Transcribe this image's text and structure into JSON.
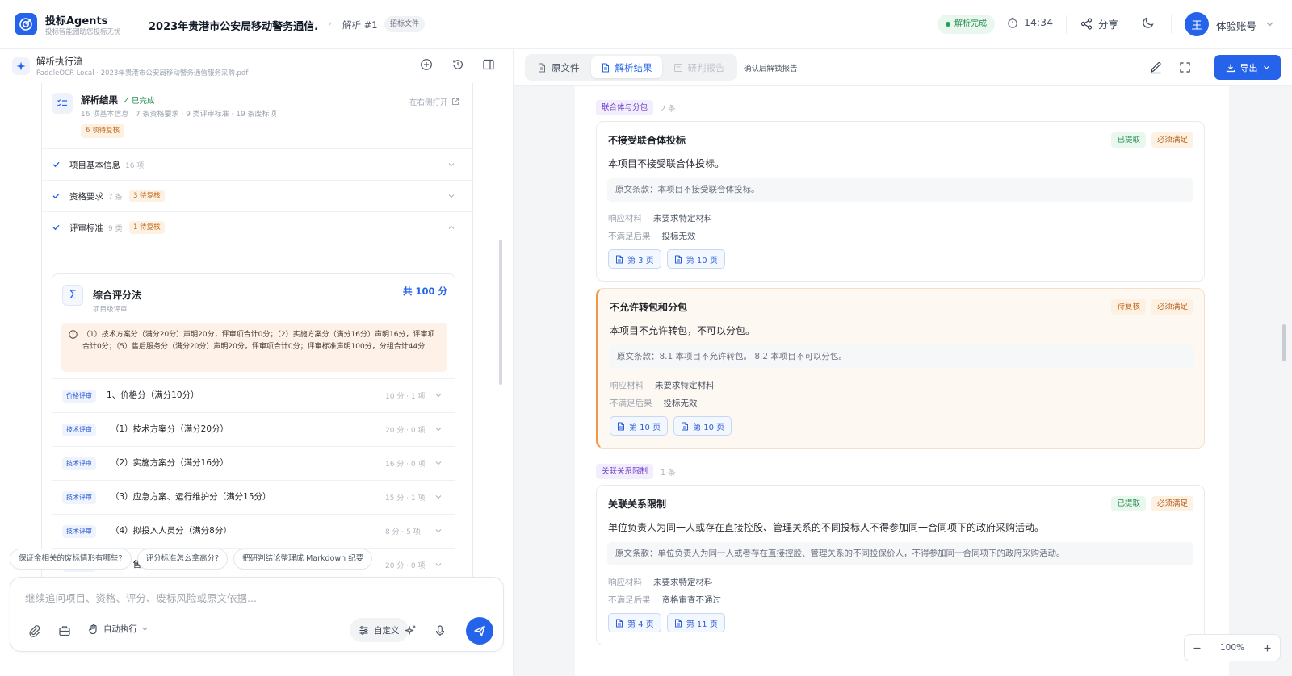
{
  "app": {
    "name": "投标Agents",
    "tagline": "投标智能团助您投标无忧",
    "title": "2023年贵港市公安局移动警务通信...",
    "run": "解析 #1",
    "doc_tag": "招标文件"
  },
  "header": {
    "status": "解析完成",
    "timer": "14:34",
    "share": "分享",
    "avatar_initial": "王",
    "account": "体验账号"
  },
  "left": {
    "title": "解析执行流",
    "subtitle": "PaddleOCR Local · 2023年贵港市公安局移动警务通信服务采购.pdf",
    "result": {
      "title": "解析结果",
      "done": "✓ 已完成",
      "meta": "16 项基本信息 · 7 条资格要求 · 9 类评审标准 · 19 条废标项",
      "pending": "6 项待复核",
      "open": "在右侧打开"
    },
    "sections": [
      {
        "label": "项目基本信息",
        "count": "16 项",
        "pending": ""
      },
      {
        "label": "资格要求",
        "count": "7 条",
        "pending": "3 待复核"
      },
      {
        "label": "评审标准",
        "count": "9 类",
        "pending": "1 待复核"
      }
    ],
    "eval": {
      "title": "综合评分法",
      "subtitle": "项目级评审",
      "total": "共 100 分",
      "note": "（1）技术方案分（满分20分）声明20分，评审项合计0分；（2）实施方案分（满分16分）声明16分，评审项合计0分；（5）售后服务分（满分20分）声明20分，评审项合计0分；评审标准声明100分，分组合计44分",
      "criteria": [
        {
          "tag": "价格评审",
          "name": "1、价格分（满分10分）",
          "score": "10 分 · 1 项"
        },
        {
          "tag": "技术评审",
          "name": "（1）技术方案分（满分20分）",
          "score": "20 分 · 0 项"
        },
        {
          "tag": "技术评审",
          "name": "（2）实施方案分（满分16分）",
          "score": "16 分 · 0 项"
        },
        {
          "tag": "技术评审",
          "name": "（3）应急方案、运行维护分（满分15分）",
          "score": "15 分 · 1 项"
        },
        {
          "tag": "技术评审",
          "name": "（4）拟投入人员分（满分8分）",
          "score": "8 分 · 5 项"
        },
        {
          "tag": "技术评审",
          "name": "（5）售后服务分（满分20分）",
          "score": "20 分 · 0 项"
        }
      ]
    },
    "quick": [
      "保证金相关的废标情形有哪些?",
      "评分标准怎么拿高分?",
      "把研判结论整理成 Markdown 纪要"
    ],
    "composer": {
      "placeholder": "继续追问项目、资格、评分、废标风险或原文依据...",
      "value": "",
      "auto_label": "自动执行",
      "custom_label": "自定义"
    }
  },
  "right": {
    "tabs": [
      {
        "label": "原文件"
      },
      {
        "label": "解析结果"
      },
      {
        "label": "研判报告"
      }
    ],
    "unlock_hint": "确认后解锁报告",
    "export_label": "导出",
    "groups": [
      {
        "title": "联合体与分包",
        "count": "2 条"
      },
      {
        "title": "关联关系限制",
        "count": "1 条"
      }
    ],
    "items": [
      {
        "title": "不接受联合体投标",
        "status": "已提取",
        "required": "必须满足",
        "desc": "本项目不接受联合体投标。",
        "source": "原文条款：本项目不接受联合体投标。",
        "k1": "响应材料",
        "v1": "未要求特定材料",
        "k2": "不满足后果",
        "v2": "投标无效",
        "pages": [
          "第 3 页",
          "第 10 页"
        ]
      },
      {
        "title": "不允许转包和分包",
        "status": "待复核",
        "required": "必须满足",
        "desc": "本项目不允许转包，不可以分包。",
        "source": "原文条款：8.1 本项目不允许转包。 8.2 本项目不可以分包。",
        "k1": "响应材料",
        "v1": "未要求特定材料",
        "k2": "不满足后果",
        "v2": "投标无效",
        "pages": [
          "第 10 页",
          "第 10 页"
        ]
      },
      {
        "title": "关联关系限制",
        "status": "已提取",
        "required": "必须满足",
        "desc": "单位负责人为同一人或存在直接控股、管理关系的不同投标人不得参加同一合同项下的政府采购活动。",
        "source": "原文条款：单位负责人为同一人或者存在直接控股、管理关系的不同投保价人，不得参加同一合同项下的政府采购活动。",
        "k1": "响应材料",
        "v1": "未要求特定材料",
        "k2": "不满足后果",
        "v2": "资格审查不通过",
        "pages": [
          "第 4 页",
          "第 11 页"
        ]
      }
    ],
    "zoom": "100%"
  },
  "colors": {
    "accent": "#2563eb",
    "success": "#1f8a4c",
    "warning": "#c2681b",
    "purple": "#6d3fc9"
  }
}
